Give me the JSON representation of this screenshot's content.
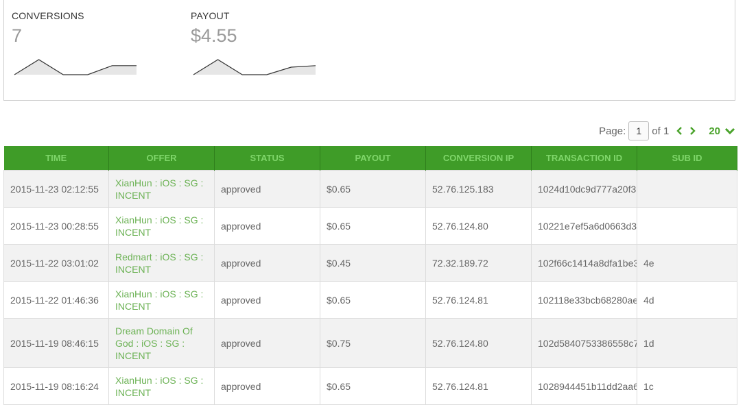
{
  "stats": {
    "conversions": {
      "label": "CONVERSIONS",
      "value": "7",
      "sparkline": [
        0,
        1,
        0,
        0,
        0.6,
        0.6
      ]
    },
    "payout": {
      "label": "PAYOUT",
      "value": "$4.55",
      "sparkline": [
        0,
        1,
        0,
        0,
        0.5,
        0.6
      ]
    }
  },
  "pager": {
    "page_label": "Page:",
    "page_value": "1",
    "of_label": "of 1",
    "page_size": "20"
  },
  "table": {
    "columns": [
      "TIME",
      "OFFER",
      "STATUS",
      "PAYOUT",
      "CONVERSION IP",
      "TRANSACTION ID",
      "SUB ID"
    ],
    "rows": [
      {
        "time": "2015-11-23 02:12:55",
        "offer": "XianHun : iOS : SG : INCENT",
        "status": "approved",
        "payout": "$0.65",
        "ip": "52.76.125.183",
        "transaction_id": "1024d10dc9d777a20f3",
        "sub_id": ""
      },
      {
        "time": "2015-11-23 00:28:55",
        "offer": "XianHun : iOS : SG : INCENT",
        "status": "approved",
        "payout": "$0.65",
        "ip": "52.76.124.80",
        "transaction_id": "10221e7ef5a6d0663d3",
        "sub_id": ""
      },
      {
        "time": "2015-11-22 03:01:02",
        "offer": "Redmart : iOS : SG : INCENT",
        "status": "approved",
        "payout": "$0.45",
        "ip": "72.32.189.72",
        "transaction_id": "102f66c1414a8dfa1be3",
        "sub_id": "4e"
      },
      {
        "time": "2015-11-22 01:46:36",
        "offer": "XianHun : iOS : SG : INCENT",
        "status": "approved",
        "payout": "$0.65",
        "ip": "52.76.124.81",
        "transaction_id": "102118e33bcb68280ae",
        "sub_id": "4d"
      },
      {
        "time": "2015-11-19 08:46:15",
        "offer": "Dream Domain Of God : iOS : SG : INCENT",
        "status": "approved",
        "payout": "$0.75",
        "ip": "52.76.124.80",
        "transaction_id": "102d5840753386558c7",
        "sub_id": "1d"
      },
      {
        "time": "2015-11-19 08:16:24",
        "offer": "XianHun : iOS : SG : INCENT",
        "status": "approved",
        "payout": "$0.65",
        "ip": "52.76.124.81",
        "transaction_id": "1028944451b11dd2aa6",
        "sub_id": "1c"
      }
    ]
  },
  "colors": {
    "header_bg": "#3f9c28",
    "header_text": "#7fd66a",
    "link": "#6cb255",
    "accent": "#4aa32b"
  },
  "icons": {
    "prev": "chevron-left-icon",
    "next": "chevron-right-icon",
    "page_size_dropdown": "chevron-down-icon"
  }
}
